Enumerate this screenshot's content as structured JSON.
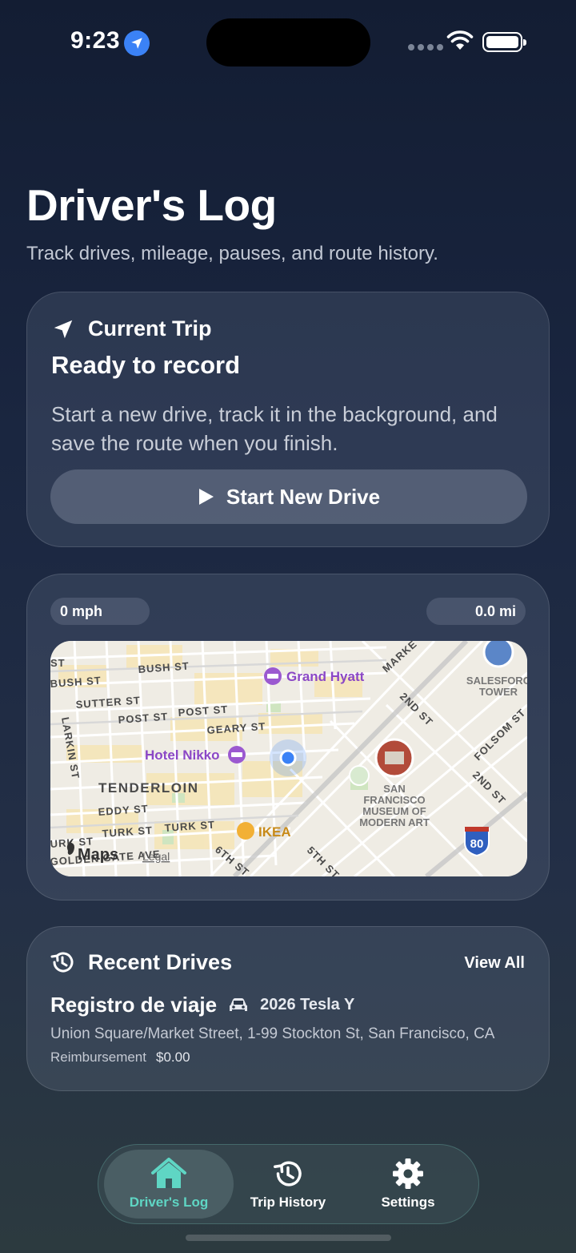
{
  "status_bar": {
    "time": "9:23"
  },
  "header": {
    "title": "Driver's Log",
    "subtitle": "Track drives, mileage, pauses, and route history."
  },
  "current_trip": {
    "label": "Current Trip",
    "status": "Ready to record",
    "description": "Start a new drive, track it in the background, and save the route when you finish.",
    "button_label": "Start New Drive"
  },
  "live_stats": {
    "speed": "0 mph",
    "distance": "0.0 mi"
  },
  "map": {
    "labels": {
      "bush_st_top": "BUSH ST",
      "bush_st_left": "BUSH ST",
      "st_corner": "ST",
      "sutter_st": "SUTTER ST",
      "post_st_1": "POST ST",
      "post_st_2": "POST ST",
      "geary_st": "GEARY ST",
      "larkin_st": "LARKIN ST",
      "tenderloin": "TENDERLOIN",
      "eddy_st": "EDDY ST",
      "turk_st_1": "URK ST",
      "turk_st_2": "TURK ST",
      "turk_st_3": "TURK ST",
      "golden_gate": "GOLDEN GATE AVE",
      "sixth_st": "6TH ST",
      "fifth_st": "5TH ST",
      "market": "MARKE",
      "second_st_1": "2ND ST",
      "second_st_2": "2ND ST",
      "folsom_st": "FOLSOM ST",
      "salesforce": "SALESFORC",
      "tower": "TOWER",
      "museum_1": "SAN",
      "museum_2": "FRANCISCO",
      "museum_3": "MUSEUM OF",
      "museum_4": "MODERN ART",
      "highway": "80"
    },
    "pois": {
      "grand_hyatt": "Grand Hyatt",
      "hotel_nikko": "Hotel Nikko",
      "ikea": "IKEA"
    },
    "attribution": {
      "maps": "Maps",
      "legal": "Legal"
    }
  },
  "recent_drives": {
    "title": "Recent Drives",
    "view_all": "View All",
    "items": [
      {
        "name": "Registro de viaje",
        "vehicle": "2026 Tesla Y",
        "address": "Union Square/Market Street, 1-99 Stockton St, San Francisco, CA",
        "reimbursement_label": "Reimbursement",
        "reimbursement_value": "$0.00"
      }
    ]
  },
  "tab_bar": {
    "tabs": [
      {
        "label": "Driver's Log"
      },
      {
        "label": "Trip History"
      },
      {
        "label": "Settings"
      }
    ]
  },
  "colors": {
    "accent": "#5fd6c4",
    "location_blue": "#3b82f6",
    "map_background": "#efece4",
    "map_poi_purple": "#9b59d0",
    "highway_shield": "#2f5fbf"
  }
}
